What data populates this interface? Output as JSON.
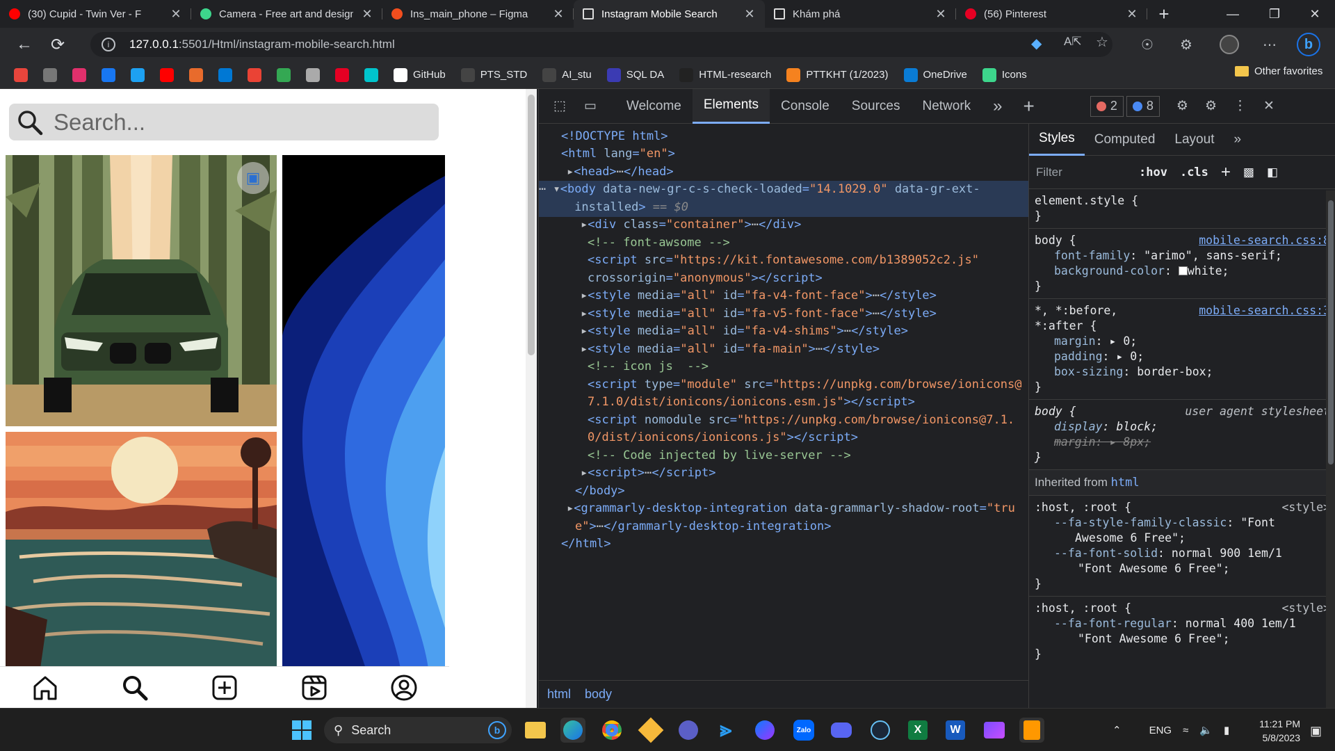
{
  "browser": {
    "tabs": [
      {
        "title": "(30) Cupid - Twin Ver - F",
        "icon": "youtube-icon",
        "color": "#ff0000"
      },
      {
        "title": "Camera - Free art and design",
        "icon": "vectorizer-icon",
        "color": "#3dd68c"
      },
      {
        "title": "Ins_main_phone – Figma",
        "icon": "figma-icon",
        "color": "#f24e1e"
      },
      {
        "title": "Instagram Mobile Search",
        "icon": "page-icon",
        "color": "#ffffff",
        "active": true
      },
      {
        "title": "Khám phá",
        "icon": "page-icon",
        "color": "#ffffff"
      },
      {
        "title": "(56) Pinterest",
        "icon": "pinterest-icon",
        "color": "#e60023"
      }
    ],
    "url_host": "127.0.0.1",
    "url_rest": ":5501/Html/instagram-mobile-search.html",
    "bookmarks": [
      {
        "label": "",
        "color": "#e8453c"
      },
      {
        "label": "",
        "color": "#777777"
      },
      {
        "label": "",
        "color": "#e1306c"
      },
      {
        "label": "",
        "color": "#1877f2"
      },
      {
        "label": "",
        "color": "#1da1f2"
      },
      {
        "label": "",
        "color": "#ff0000"
      },
      {
        "label": "",
        "color": "#e86b2c"
      },
      {
        "label": "",
        "color": "#0078d4"
      },
      {
        "label": "",
        "color": "#ea4335"
      },
      {
        "label": "",
        "color": "#34a853"
      },
      {
        "label": "",
        "color": "#aaaaaa"
      },
      {
        "label": "",
        "color": "#e60023"
      },
      {
        "label": "",
        "color": "#00c4cc"
      },
      {
        "label": "GitHub",
        "color": "#ffffff"
      },
      {
        "label": "PTS_STD",
        "color": "#444444"
      },
      {
        "label": "AI_stu",
        "color": "#444444"
      },
      {
        "label": "SQL DA",
        "color": "#3b3bb3"
      },
      {
        "label": "HTML-research",
        "color": "#222222"
      },
      {
        "label": "PTTKHT (1/2023)",
        "color": "#f5821f"
      },
      {
        "label": "OneDrive",
        "color": "#0a7cd5"
      },
      {
        "label": "Icons",
        "color": "#3dd68c"
      }
    ],
    "other_favorites": "Other favorites"
  },
  "page": {
    "search_placeholder": "Search..."
  },
  "devtools": {
    "tabs": [
      "Welcome",
      "Elements",
      "Console",
      "Sources",
      "Network"
    ],
    "active_tab": "Elements",
    "errors": "2",
    "messages": "8",
    "breadcrumb": [
      "html",
      "body"
    ],
    "styles_tabs": [
      "Styles",
      "Computed",
      "Layout"
    ],
    "filter_placeholder": "Filter",
    "hov": ":hov",
    "cls": ".cls",
    "element_style": "element.style {",
    "body_source": "mobile-search.css:8",
    "universal_source": "mobile-search.css:3",
    "ua_label": "user agent stylesheet",
    "inherited_label": "Inherited from",
    "inherited_tag": "html",
    "style_tag": "<style>"
  },
  "taskbar": {
    "search_label": "Search",
    "lang": "ENG",
    "time": "11:21 PM",
    "date": "5/8/2023"
  }
}
